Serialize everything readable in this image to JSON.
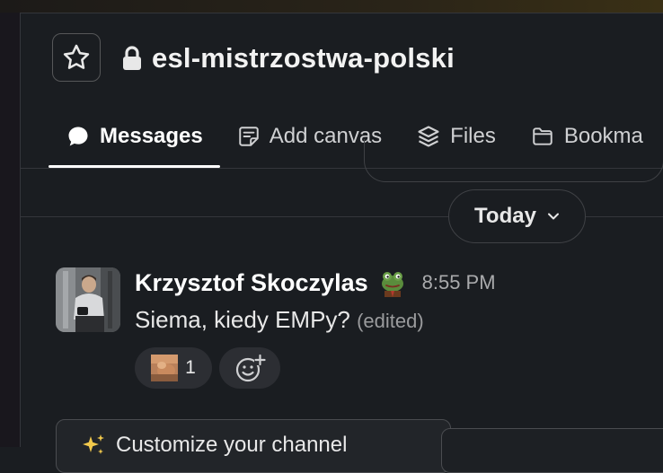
{
  "header": {
    "channel_name": "esl-mistrzostwa-polski"
  },
  "tabs": [
    {
      "label": "Messages",
      "icon": "chat-bubble-icon",
      "active": true
    },
    {
      "label": "Add canvas",
      "icon": "canvas-icon",
      "active": false
    },
    {
      "label": "Files",
      "icon": "files-stack-icon",
      "active": false
    },
    {
      "label": "Bookma",
      "icon": "folder-icon",
      "active": false
    }
  ],
  "date_divider": {
    "label": "Today"
  },
  "message": {
    "author": "Krzysztof Skoczylas",
    "time": "8:55 PM",
    "text": "Siema, kiedy EMPy?",
    "edited_label": "(edited)",
    "reaction_count": "1"
  },
  "customize": {
    "label": "Customize your channel"
  },
  "colors": {
    "background": "#1a1d21",
    "divider": "#34363b",
    "pill": "#2c2e33",
    "text": "#e8e8e8",
    "muted": "#a9aaac"
  }
}
